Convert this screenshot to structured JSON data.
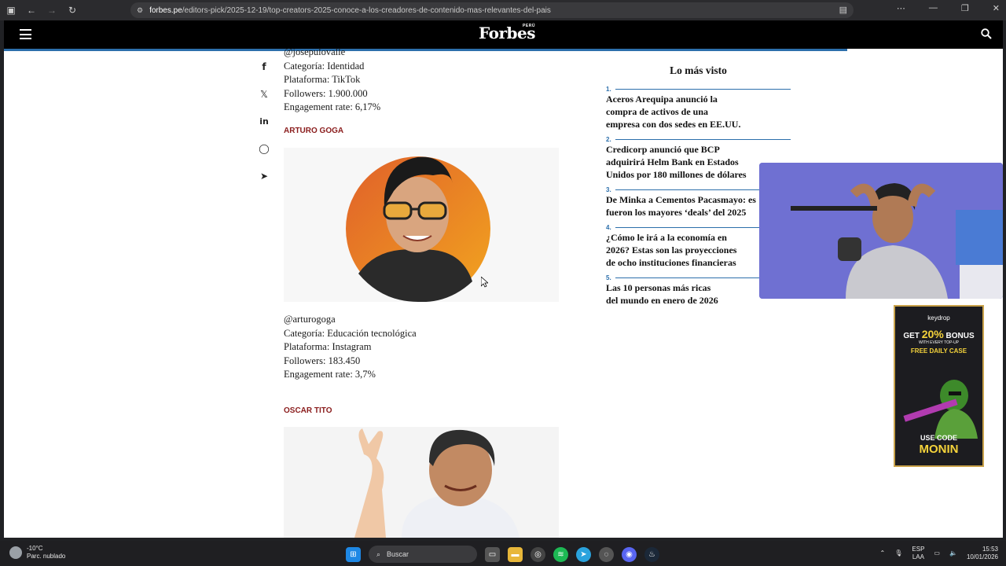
{
  "browser": {
    "url_host": "forbes.pe",
    "url_path": "/editors-pick/2025-12-19/top-creators-2025-conoce-a-los-creadores-de-contenido-mas-relevantes-del-pais"
  },
  "header": {
    "logo": "Forbes",
    "logo_sub": "PERÚ"
  },
  "creator_prev": {
    "handle": "@josepulovalle",
    "categoria": "Categoría: Identidad",
    "plataforma": "Plataforma: TikTok",
    "followers": "Followers: 1.900.000",
    "engagement": "Engagement rate: 6,17%"
  },
  "creator_arturo": {
    "name": "ARTURO GOGA",
    "handle": "@arturogoga",
    "categoria": "Categoría: Educación tecnológica",
    "plataforma": "Plataforma: Instagram",
    "followers": "Followers: 183.450",
    "engagement": "Engagement rate: 3,7%"
  },
  "creator_oscar": {
    "name": "OSCAR TITO"
  },
  "sidebar": {
    "title": "Lo más visto",
    "items": [
      {
        "num": "1.",
        "text": "Aceros Arequipa anunció la\ncompra de activos de una\nempresa con dos sedes en EE.UU."
      },
      {
        "num": "2.",
        "text": "Credicorp anunció que BCP\nadquirirá Helm Bank en Estados\nUnidos por 180 millones de dólares"
      },
      {
        "num": "3.",
        "text": "De Minka a Cementos Pacasmayo: es\nfueron los mayores ‘deals’ del 2025"
      },
      {
        "num": "4.",
        "text": "¿Cómo le irá a la economía en\n2026? Estas son las proyecciones\nde ocho instituciones financieras"
      },
      {
        "num": "5.",
        "text": "Las 10 personas más ricas\ndel mundo en enero de 2026"
      }
    ]
  },
  "ad": {
    "brand": "keydrop",
    "get": "GET",
    "bonus": "20%",
    "bonus_word": "BONUS",
    "topup": "WITH EVERY TOP-UP",
    "daily": "FREE DAILY CASE",
    "use_code": "USE CODE",
    "code": "MONIN"
  },
  "taskbar": {
    "temp": "-10°C",
    "weather": "Parc. nublado",
    "search": "Buscar",
    "lang": "ESP",
    "layout": "LAA",
    "time": "15:53",
    "date": "10/01/2026"
  }
}
